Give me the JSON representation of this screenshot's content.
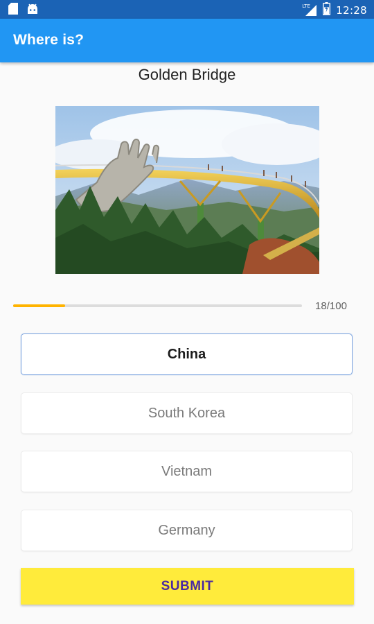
{
  "status_bar": {
    "time": "12:28",
    "network": "LTE",
    "battery_level": 0.7,
    "icons": [
      "sd-card-icon",
      "android-icon",
      "signal-icon",
      "battery-icon"
    ]
  },
  "app_bar": {
    "title": "Where is?",
    "color": "#2196f3"
  },
  "question": {
    "title": "Golden Bridge",
    "image_icon": "golden-bridge-photo"
  },
  "progress": {
    "current": 18,
    "total": 100,
    "label": "18/100",
    "fraction": 0.18,
    "color": "#ffb300"
  },
  "options": [
    {
      "label": "China",
      "selected": true
    },
    {
      "label": "South Korea",
      "selected": false
    },
    {
      "label": "Vietnam",
      "selected": false
    },
    {
      "label": "Germany",
      "selected": false
    }
  ],
  "submit": {
    "label": "SUBMIT",
    "background": "#ffeb3b",
    "text_color": "#4a2aa0"
  }
}
